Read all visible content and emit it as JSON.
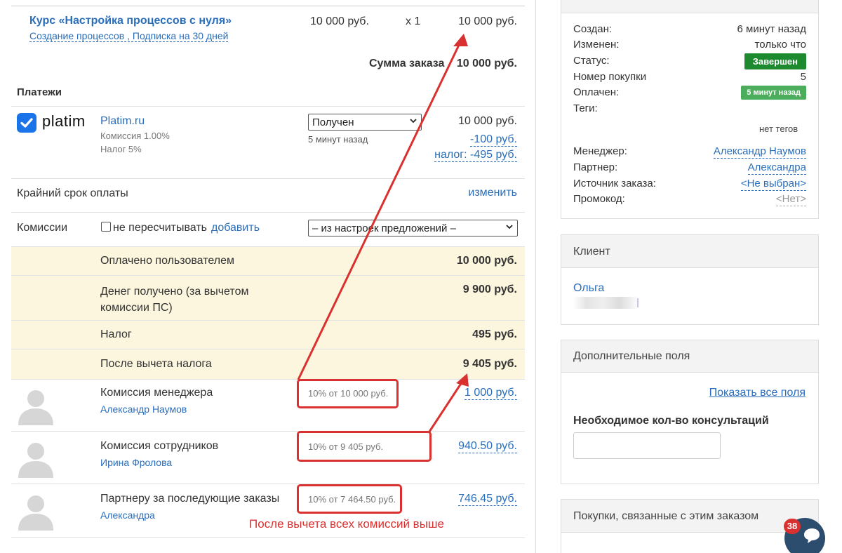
{
  "order_item": {
    "title": "Курс «Настройка процессов с нуля»",
    "subtitle": "Создание процессов , Подписка на 30 дней",
    "price": "10 000 руб.",
    "qty": "x 1",
    "total": "10 000 руб."
  },
  "order_sum": {
    "label": "Сумма заказа",
    "value": "10 000 руб."
  },
  "payments": {
    "heading": "Платежи",
    "logo_text": "platim",
    "provider": "Platim.ru",
    "commission": "Комиссия 1.00%",
    "tax": "Налог 5%",
    "status_select": "Получен",
    "status_time": "5 минут назад",
    "amount": "10 000 руб.",
    "fee": "-100 руб.",
    "tax_amount": "налог: -495 руб."
  },
  "deadline": {
    "label": "Крайний срок оплаты",
    "action": "изменить"
  },
  "commissions": {
    "label": "Комиссии",
    "checkbox_label": "не пересчитывать",
    "add_link": "добавить",
    "select_value": "– из настроек предложений –"
  },
  "summary": [
    {
      "label": "Оплачено пользователем",
      "value": "10 000 руб."
    },
    {
      "label": "Денег получено (за вычетом\nкомиссии ПС)",
      "value": "9 900 руб."
    },
    {
      "label": "Налог",
      "value": "495 руб."
    },
    {
      "label": "После вычета налога",
      "value": "9 405 руб."
    }
  ],
  "commission_rows": [
    {
      "title": "Комиссия менеджера",
      "person": "Александр Наумов",
      "formula": "10% от 10 000 руб.",
      "amount": "1 000 руб."
    },
    {
      "title": "Комиссия сотрудников",
      "person": "Ирина Фролова",
      "formula": "10% от 9 405 руб.",
      "amount": "940.50 руб."
    },
    {
      "title": "Партнеру за последующие заказы",
      "person": "Александра",
      "formula": "10% от 7 464.50 руб.",
      "amount": "746.45 руб."
    }
  ],
  "annotation": "После вычета всех комиссий выше",
  "info_panel": {
    "rows": [
      {
        "label": "Создан:",
        "value": "6 минут назад"
      },
      {
        "label": "Изменен:",
        "value": "только что"
      },
      {
        "label": "Статус:",
        "value": "Завершен"
      },
      {
        "label": "Номер покупки",
        "value": "5"
      },
      {
        "label": "Оплачен:",
        "value": "5 минут назад"
      },
      {
        "label": "Теги:",
        "value": "нет тегов"
      },
      {
        "label": "Менеджер:",
        "value": "Александр Наумов"
      },
      {
        "label": "Партнер:",
        "value": "Александра"
      },
      {
        "label": "Источник заказа:",
        "value": "<Не выбран>"
      },
      {
        "label": "Промокод:",
        "value": "<Нет>"
      }
    ]
  },
  "client_panel": {
    "heading": "Клиент",
    "name": "Ольга"
  },
  "extra_fields_panel": {
    "heading": "Дополнительные поля",
    "show_all": "Показать все поля",
    "field_label": "Необходимое кол-во консультаций",
    "field_value": ""
  },
  "related_panel": {
    "heading": "Покупки, связанные с этим заказом"
  },
  "chat_badge": {
    "count": "38"
  },
  "colors": {
    "link": "#2a6ebb",
    "highlight": "#fcf6de",
    "annotation_red": "#d9312f",
    "status_green": "#1e8a2f"
  }
}
